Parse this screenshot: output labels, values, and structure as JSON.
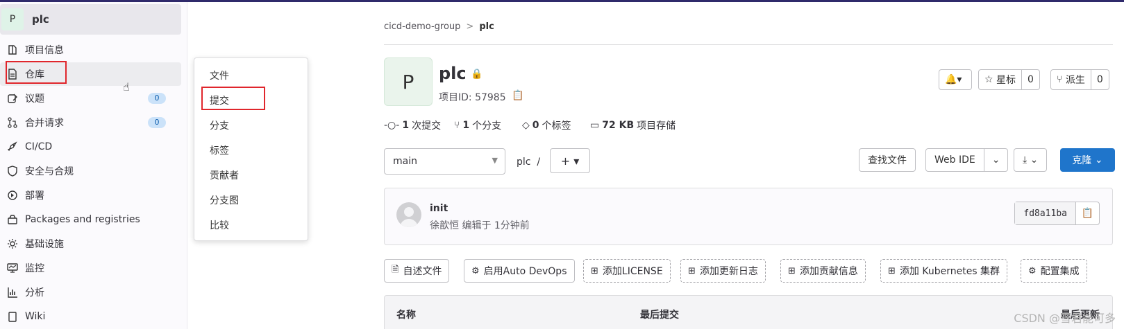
{
  "project": {
    "avatar_letter": "P",
    "name": "plc",
    "id_label": "项目ID: 57985"
  },
  "sidebar": {
    "items": [
      {
        "label": "项目信息",
        "icon": "project-icon"
      },
      {
        "label": "仓库",
        "icon": "document-icon"
      },
      {
        "label": "议题",
        "icon": "issues-icon",
        "count": "0"
      },
      {
        "label": "合并请求",
        "icon": "merge-request-icon",
        "count": "0"
      },
      {
        "label": "CI/CD",
        "icon": "rocket-icon"
      },
      {
        "label": "安全与合规",
        "icon": "shield-icon"
      },
      {
        "label": "部署",
        "icon": "deployments-icon"
      },
      {
        "label": "Packages and registries",
        "icon": "package-icon"
      },
      {
        "label": "基础设施",
        "icon": "cloud-gear-icon"
      },
      {
        "label": "监控",
        "icon": "monitor-icon"
      },
      {
        "label": "分析",
        "icon": "chart-icon"
      },
      {
        "label": "Wiki",
        "icon": "book-icon"
      }
    ]
  },
  "flyout": {
    "items": [
      "文件",
      "提交",
      "分支",
      "标签",
      "贡献者",
      "分支图",
      "比较"
    ]
  },
  "breadcrumb": {
    "group": "cicd-demo-group",
    "sep": ">",
    "current": "plc"
  },
  "header_actions": {
    "star_label": "星标",
    "star_count": "0",
    "fork_label": "派生",
    "fork_count": "0"
  },
  "stats": [
    {
      "value": "1",
      "label": "次提交"
    },
    {
      "value": "1",
      "label": "个分支"
    },
    {
      "value": "0",
      "label": "个标签"
    },
    {
      "value": "72 KB",
      "label": "项目存储"
    }
  ],
  "toolbar": {
    "branch": "main",
    "path": "plc",
    "path_sep": "/",
    "add": "+",
    "find_file": "查找文件",
    "web_ide": "Web IDE",
    "clone": "克隆"
  },
  "commit": {
    "message": "init",
    "meta": "徐歆恒 编辑于 1分钟前",
    "sha": "fd8a11ba"
  },
  "quick_actions": [
    {
      "label": "自述文件",
      "style": "solid"
    },
    {
      "label": "启用Auto DevOps",
      "style": "solid"
    },
    {
      "label": "添加LICENSE",
      "style": "dash"
    },
    {
      "label": "添加更新日志",
      "style": "dash"
    },
    {
      "label": "添加贡献信息",
      "style": "dash"
    },
    {
      "label": "添加 Kubernetes 集群",
      "style": "dash"
    },
    {
      "label": "配置集成",
      "style": "dash"
    }
  ],
  "table": {
    "col_name": "名称",
    "col_commit": "最后提交",
    "col_updated": "最后更新"
  },
  "watermark": "CSDN @雪君能可多"
}
